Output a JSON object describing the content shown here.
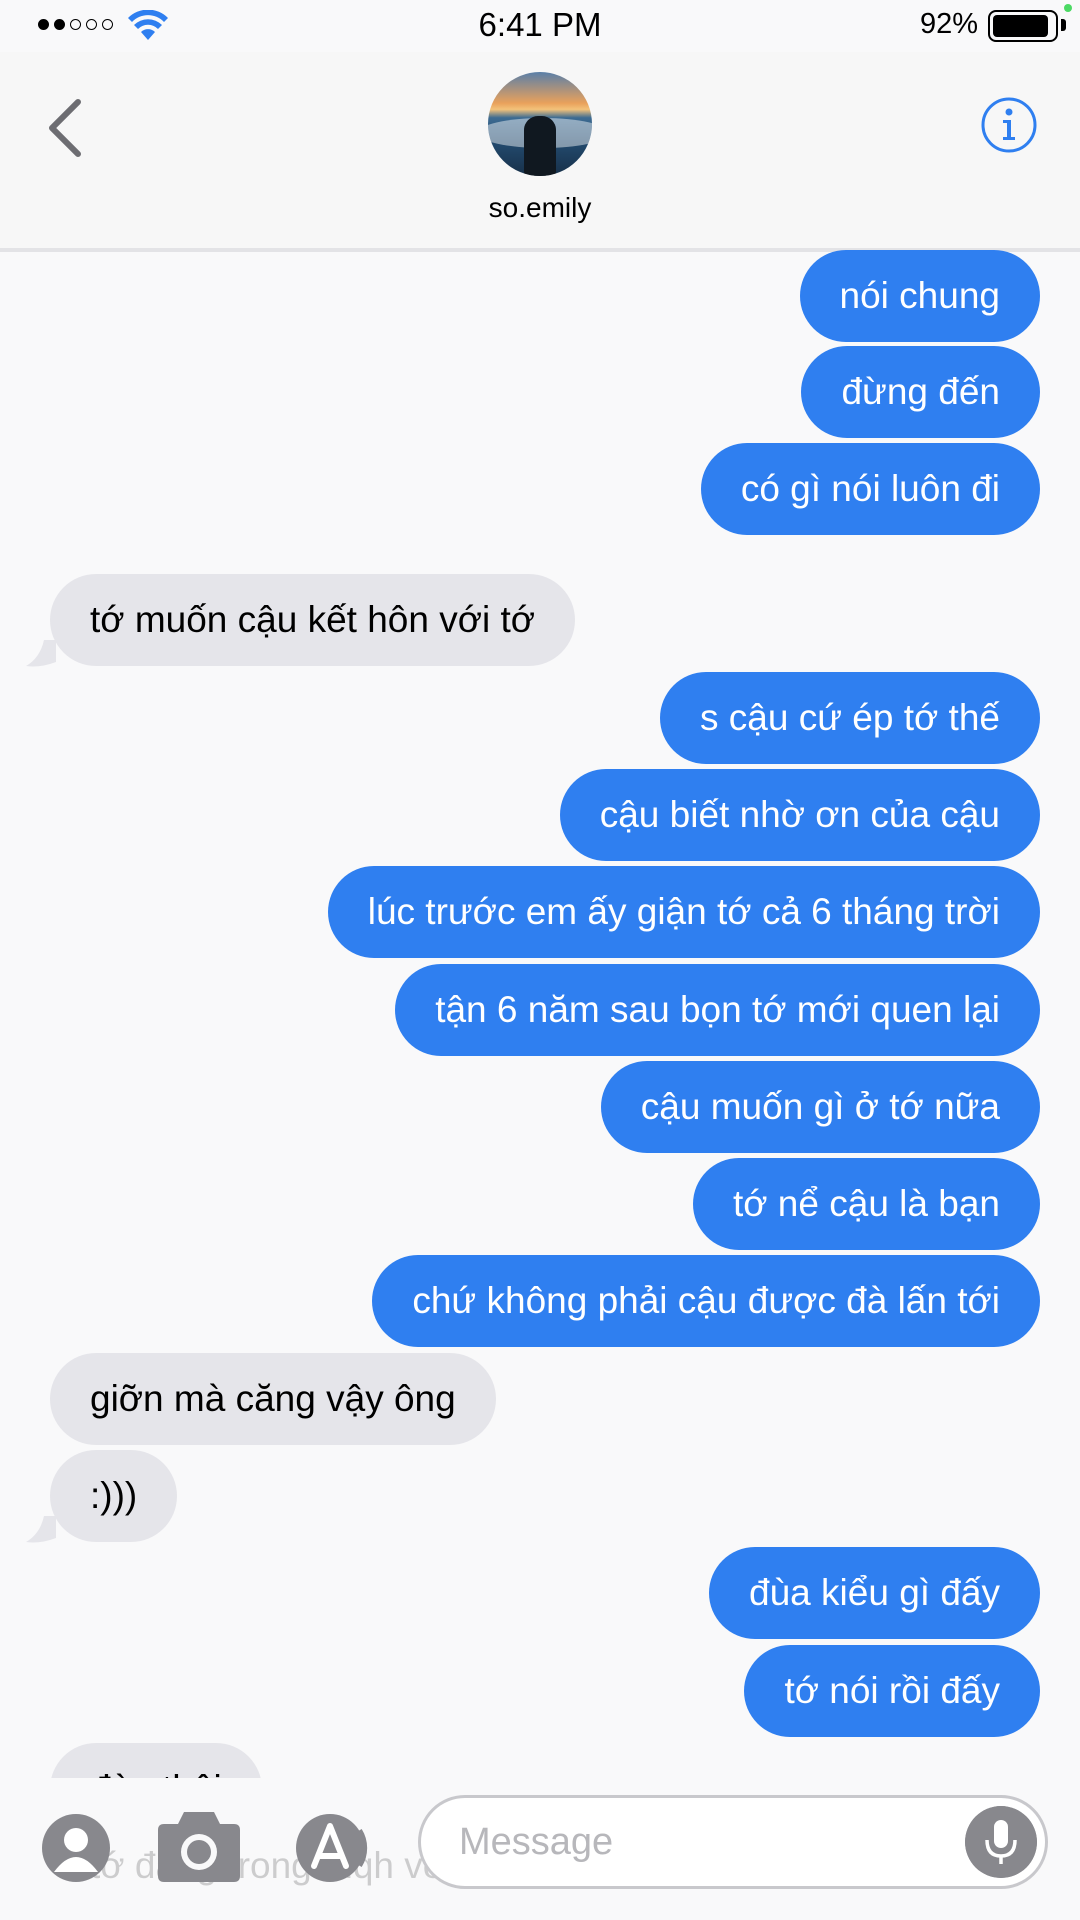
{
  "status_bar": {
    "time": "6:41 PM",
    "battery_percent": "92%",
    "signal_bars_filled": 2,
    "signal_bars_total": 5
  },
  "header": {
    "contact_name": "so.emily",
    "back_icon": "chevron-left-icon",
    "info_icon": "info-icon"
  },
  "colors": {
    "outgoing_bubble": "#2f7ff0",
    "incoming_bubble": "#e5e5ea",
    "accent": "#2f7ff0"
  },
  "messages": [
    {
      "dir": "out",
      "text": "nói chung"
    },
    {
      "dir": "out",
      "text": "đừng đến"
    },
    {
      "dir": "out",
      "text": "có gì nói luôn đi"
    },
    {
      "dir": "in",
      "text": "tớ muốn cậu kết hôn với tớ"
    },
    {
      "dir": "out",
      "text": "s cậu cứ ép tớ thế"
    },
    {
      "dir": "out",
      "text": "cậu biết nhờ ơn của cậu"
    },
    {
      "dir": "out",
      "text": "lúc trước em ấy giận tớ cả 6 tháng trời"
    },
    {
      "dir": "out",
      "text": "tận 6 năm sau bọn tớ mới quen lại"
    },
    {
      "dir": "out",
      "text": "cậu muốn gì ở tớ nữa"
    },
    {
      "dir": "out",
      "text": "tớ nể cậu là bạn"
    },
    {
      "dir": "out",
      "text": "chứ không phải cậu được đà lấn tới"
    },
    {
      "dir": "in",
      "text": "giỡn mà căng vậy ông"
    },
    {
      "dir": "in",
      "text": ":)))"
    },
    {
      "dir": "out",
      "text": "đùa kiểu gì đấy"
    },
    {
      "dir": "out",
      "text": "tớ nói rồi đấy"
    },
    {
      "dir": "in",
      "text": "đùa thôi"
    }
  ],
  "behind_input_text": "tớ đang trong mqh với bạn trai tớ rồi",
  "input": {
    "placeholder": "Message",
    "icons": [
      "contacts-icon",
      "camera-icon",
      "app-store-icon",
      "microphone-icon"
    ]
  }
}
